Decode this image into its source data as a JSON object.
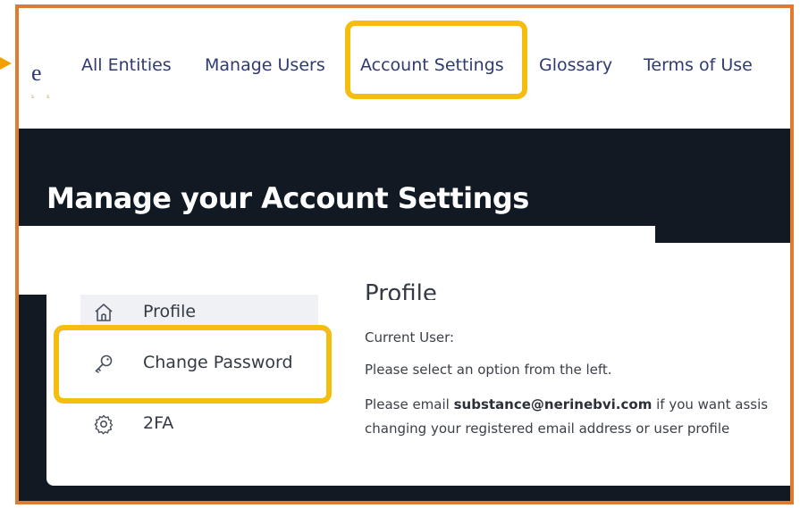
{
  "brand": {
    "logo_letter": "e",
    "logo_sub": "s s"
  },
  "nav": {
    "items": [
      {
        "label": "All Entities"
      },
      {
        "label": "Manage Users"
      },
      {
        "label": "Account Settings"
      },
      {
        "label": "Glossary"
      },
      {
        "label": "Terms of Use"
      }
    ]
  },
  "hero": {
    "title": "Manage your Account Settings"
  },
  "sidebar": {
    "items": [
      {
        "label": "Profile",
        "icon": "home-icon"
      },
      {
        "label": "Change Password",
        "icon": "key-icon"
      },
      {
        "label": "2FA",
        "icon": "gear-icon"
      }
    ]
  },
  "profile": {
    "title": "Profile",
    "current_user_label": "Current User:",
    "instruction": "Please select an option from the left.",
    "email_prefix": "Please email ",
    "email": "substance@nerinebvi.com",
    "email_suffix": " if you want assis",
    "line2": "changing your registered email address or user profile"
  },
  "colors": {
    "frame": "#E07A2E",
    "highlight": "#F4BE10",
    "dark": "#111923",
    "nav_text": "#2f3a73"
  }
}
